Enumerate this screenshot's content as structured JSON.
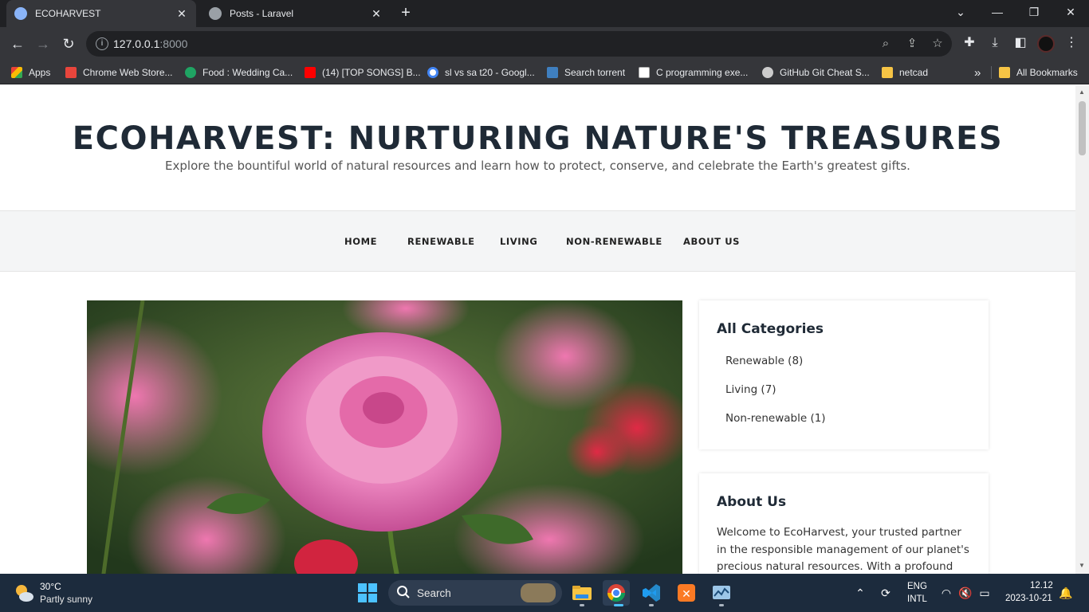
{
  "browser": {
    "tabs": [
      {
        "title": "ECOHARVEST",
        "active": true
      },
      {
        "title": "Posts - Laravel",
        "active": false
      }
    ],
    "new_tab_symbol": "+",
    "tab_close_symbol": "✕",
    "url_host": "127.0.0.1",
    "url_port": ":8000",
    "bookmarks": [
      {
        "label": "Apps",
        "icon": "apps-grid-icon",
        "color": "#ea4335"
      },
      {
        "label": "Chrome Web Store...",
        "icon": "chrome-web-store-icon",
        "color": "#e8453c"
      },
      {
        "label": "Food : Wedding Ca...",
        "icon": "food-site-icon",
        "color": "#1fa463"
      },
      {
        "label": "(14) [TOP SONGS] B...",
        "icon": "youtube-icon",
        "color": "#ff0000"
      },
      {
        "label": "sl vs sa t20 - Googl...",
        "icon": "google-icon",
        "color": "#4285f4"
      },
      {
        "label": "Search torrent",
        "icon": "torrent-icon",
        "color": "#3f7fbf"
      },
      {
        "label": "C programming exe...",
        "icon": "w3resource-icon",
        "color": "#ffffff"
      },
      {
        "label": "GitHub Git Cheat S...",
        "icon": "github-icon",
        "color": "#cccccc"
      },
      {
        "label": "netcad",
        "icon": "folder-icon",
        "color": "#f6c445"
      }
    ],
    "overflow_symbol": "»",
    "all_bookmarks_label": "All Bookmarks"
  },
  "site": {
    "title": "ECOHARVEST: NURTURING NATURE'S TREASURES",
    "tagline": "Explore the bountiful world of natural resources and learn how to protect, conserve, and celebrate the Earth's greatest gifts.",
    "nav": [
      "HOME",
      "RENEWABLE",
      "LIVING",
      "NON-RENEWABLE",
      "ABOUT US"
    ],
    "categories_heading": "All Categories",
    "categories": [
      "Renewable (8)",
      "Living (7)",
      "Non-renewable (1)"
    ],
    "about_heading": "About Us",
    "about_text": "Welcome to EcoHarvest, your trusted partner in the responsible management of our planet's precious natural resources. With a profound"
  },
  "taskbar": {
    "weather_temp": "30°C",
    "weather_desc": "Partly sunny",
    "search_label": "Search",
    "lang_line1": "ENG",
    "lang_line2": "INTL",
    "time": "12.12",
    "date": "2023-10-21"
  },
  "colors": {
    "browser_dark": "#202124",
    "browser_toolbar": "#35363a",
    "title_text": "#1f2a36",
    "nav_background": "#f4f5f6",
    "taskbar": "#1c2b3d"
  }
}
